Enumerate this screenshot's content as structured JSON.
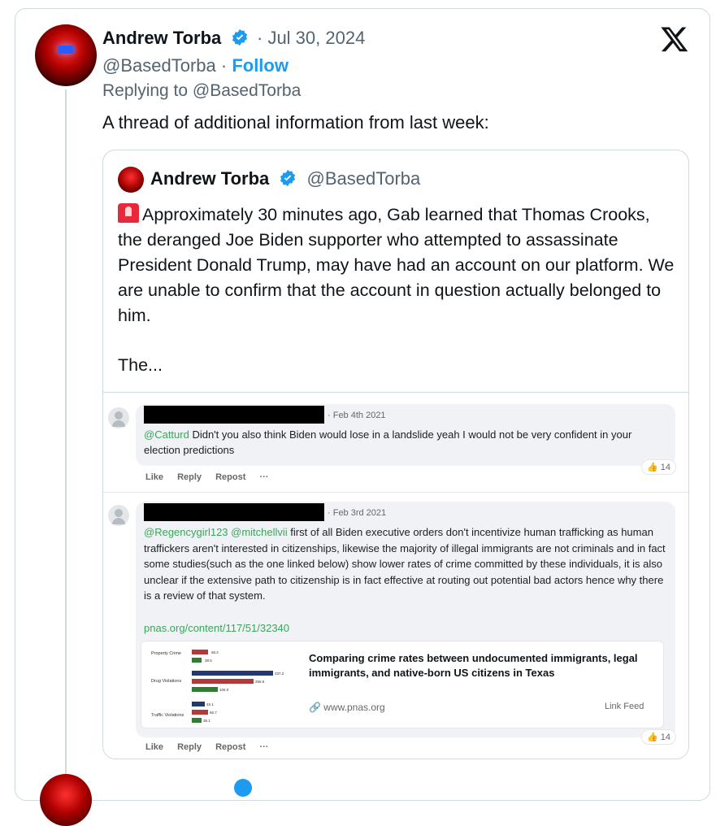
{
  "post": {
    "author_name": "Andrew Torba",
    "date": "· Jul 30, 2024",
    "handle": "@BasedTorba",
    "dot": " · ",
    "follow_label": "Follow",
    "replying_to": "Replying to @BasedTorba",
    "text": "A thread of additional information from last week:"
  },
  "quote": {
    "author_name": "Andrew Torba",
    "handle": "@BasedTorba",
    "text": "Approximately 30 minutes ago, Gab learned that Thomas Crooks, the deranged Joe Biden supporter who attempted to assassinate President Donald Trump, may have had an account on our platform. We are unable to confirm that the account in question actually belonged to him.",
    "truncated": "The..."
  },
  "comments": [
    {
      "date": "· Feb 4th 2021",
      "mention": "@Catturd",
      "text": " Didn't you also think Biden would lose in a landslide yeah I would not be very confident in your election predictions",
      "like": "Like",
      "reply": "Reply",
      "repost": "Repost",
      "more": "···",
      "likes": "14"
    },
    {
      "date": "· Feb 3rd 2021",
      "mention": "@Regencygirl123 @mitchellvii",
      "text": " first of all Biden executive orders don't incentivize human trafficking as human traffickers aren't interested in citizenships, likewise the majority of illegal immigrants are not criminals and in fact some studies(such as the one linked below) show lower rates of crime committed by these individuals, it is also unclear if the extensive path to citizenship is in fact effective at routing out potential bad actors hence why there is a review of that system.",
      "link": "pnas.org/content/117/51/32340",
      "like": "Like",
      "reply": "Reply",
      "repost": "Repost",
      "more": "···",
      "likes": "14"
    }
  ],
  "link_preview": {
    "title": "Comparing crime rates between undocumented immigrants, legal immigrants, and native-born US citizens in Texas",
    "site": "www.pnas.org",
    "feed": "Link Feed",
    "chart": {
      "categories": [
        "Property Crime",
        "Drug Violations",
        "Traffic Violations"
      ],
      "values": [
        [
          "66.2",
          "38.5",
          ""
        ],
        [
          "337.2",
          "255.6",
          "106.0"
        ],
        [
          "45.1",
          "66.7",
          "38.1"
        ]
      ],
      "colors": [
        "#1f3a6b",
        "#b23a3a",
        "#2e7d32"
      ]
    }
  },
  "icons": {
    "verified": "verified-badge-icon",
    "x_logo": "x-logo-icon",
    "siren": "police-siren-icon",
    "thumb": "thumbs-up-icon",
    "chain": "link-icon"
  }
}
